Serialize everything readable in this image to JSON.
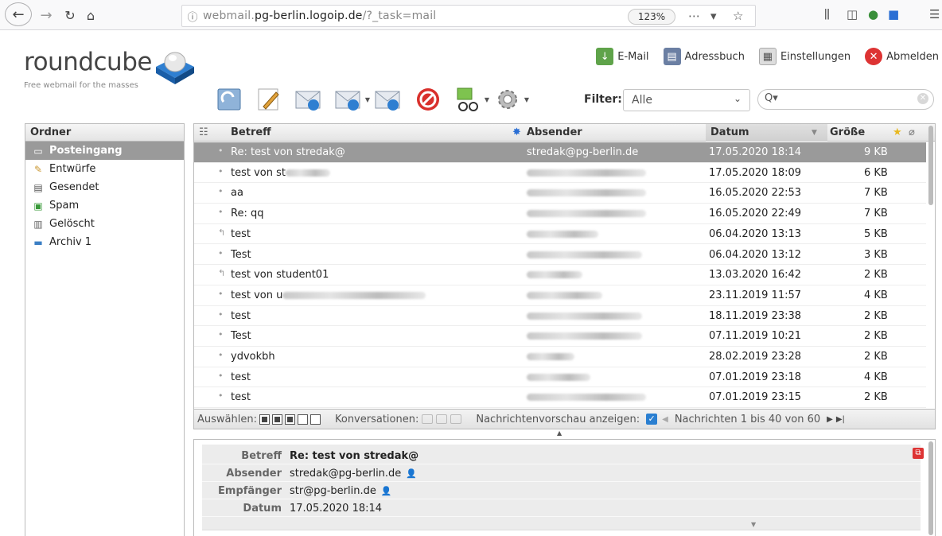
{
  "browser": {
    "url_prefix": "webmail.",
    "url_domain": "pg-berlin.logoip.de",
    "url_suffix": "/?_task=mail",
    "zoom": "123%"
  },
  "app": {
    "logo_text": "roundcube",
    "logo_tagline": "Free webmail for the masses"
  },
  "topnav": {
    "email": "E-Mail",
    "addressbook": "Adressbuch",
    "settings": "Einstellungen",
    "logout": "Abmelden"
  },
  "filter": {
    "label": "Filter:",
    "value": "Alle"
  },
  "folders": {
    "header": "Ordner",
    "items": [
      {
        "label": "Posteingang"
      },
      {
        "label": "Entwürfe"
      },
      {
        "label": "Gesendet"
      },
      {
        "label": "Spam"
      },
      {
        "label": "Gelöscht"
      },
      {
        "label": "Archiv 1"
      }
    ]
  },
  "list": {
    "columns": {
      "subject": "Betreff",
      "sender": "Absender",
      "date": "Datum",
      "size": "Größe"
    },
    "rows": [
      {
        "subject": "Re: test von stredak@",
        "sender": "stredak@pg-berlin.de",
        "date": "17.05.2020 18:14",
        "size": "9 KB"
      },
      {
        "subject": "test von st",
        "sender": "",
        "date": "17.05.2020 18:09",
        "size": "6 KB"
      },
      {
        "subject": "aa",
        "sender": "",
        "date": "16.05.2020 22:53",
        "size": "7 KB"
      },
      {
        "subject": "Re: qq",
        "sender": "",
        "date": "16.05.2020 22:49",
        "size": "7 KB"
      },
      {
        "subject": "test",
        "sender": "",
        "date": "06.04.2020 13:13",
        "size": "5 KB"
      },
      {
        "subject": "Test",
        "sender": "",
        "date": "06.04.2020 13:12",
        "size": "3 KB"
      },
      {
        "subject": "test von student01",
        "sender": "",
        "date": "13.03.2020 16:42",
        "size": "2 KB"
      },
      {
        "subject": "test von u",
        "sender": "",
        "date": "23.11.2019 11:57",
        "size": "4 KB"
      },
      {
        "subject": "test",
        "sender": "",
        "date": "18.11.2019 23:38",
        "size": "2 KB"
      },
      {
        "subject": "Test",
        "sender": "",
        "date": "07.11.2019 10:21",
        "size": "2 KB"
      },
      {
        "subject": "ydvokbh",
        "sender": "",
        "date": "28.02.2019 23:28",
        "size": "2 KB"
      },
      {
        "subject": "test",
        "sender": "",
        "date": "07.01.2019 23:18",
        "size": "4 KB"
      },
      {
        "subject": "test",
        "sender": "",
        "date": "07.01.2019 23:15",
        "size": "2 KB"
      }
    ]
  },
  "footer": {
    "select_label": "Auswählen:",
    "threads_label": "Konversationen:",
    "preview_label": "Nachrichtenvorschau anzeigen:",
    "count_text": "Nachrichten 1 bis 40 von 60"
  },
  "preview": {
    "subject_label": "Betreff",
    "subject": "Re: test von stredak@",
    "from_label": "Absender",
    "from": "stredak@pg-berlin.de",
    "to_label": "Empfänger",
    "to": "str@pg-berlin.de",
    "date_label": "Datum",
    "date": "17.05.2020 18:14"
  }
}
